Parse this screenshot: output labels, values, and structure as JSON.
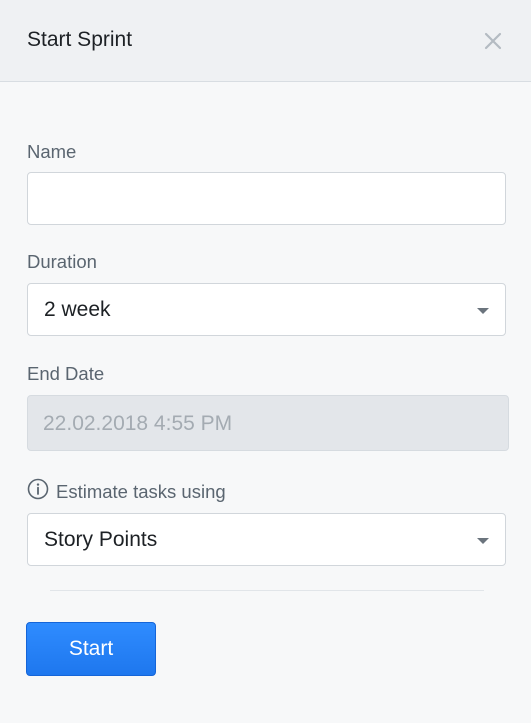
{
  "dialog": {
    "title": "Start Sprint",
    "close_icon": "close-icon"
  },
  "form": {
    "name": {
      "label": "Name",
      "value": "",
      "placeholder": ""
    },
    "duration": {
      "label": "Duration",
      "selected": "2 week"
    },
    "end_date": {
      "label": "End Date",
      "value": "22.02.2018 4:55 PM"
    },
    "estimate": {
      "label": "Estimate tasks using",
      "icon": "info-icon",
      "selected": "Story Points"
    }
  },
  "actions": {
    "start_label": "Start"
  },
  "colors": {
    "accent": "#1e77ee",
    "header_bg": "#eff1f3",
    "disabled_bg": "#e3e6ea"
  }
}
